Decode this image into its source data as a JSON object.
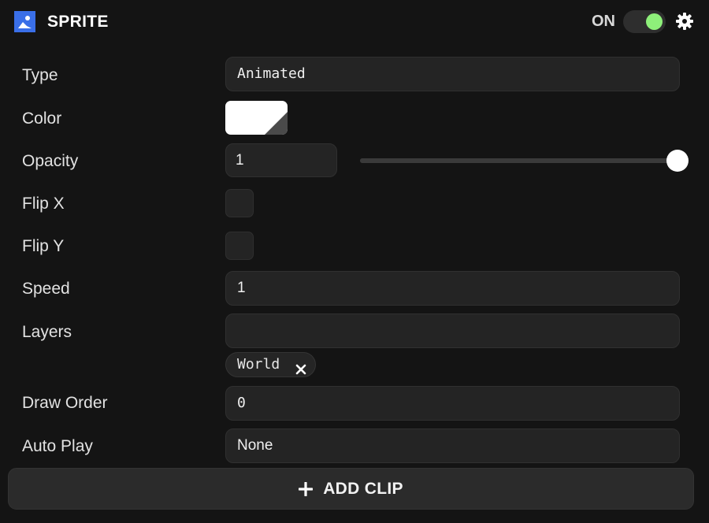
{
  "header": {
    "title": "SPRITE",
    "icon": "image-icon",
    "toggle_label": "ON",
    "toggle_on": true,
    "accent": "#3a6fe8",
    "toggle_color": "#8ef07a"
  },
  "rows": {
    "type": {
      "label": "Type",
      "value": "Animated"
    },
    "color": {
      "label": "Color",
      "value": "#ffffff"
    },
    "opacity": {
      "label": "Opacity",
      "value": "1",
      "slider_fraction": 1.0
    },
    "flip_x": {
      "label": "Flip X",
      "checked": false
    },
    "flip_y": {
      "label": "Flip Y",
      "checked": false
    },
    "speed": {
      "label": "Speed",
      "value": "1"
    },
    "layers": {
      "label": "Layers",
      "value": "",
      "chips": [
        "World"
      ]
    },
    "draw_order": {
      "label": "Draw Order",
      "value": "0"
    },
    "auto_play": {
      "label": "Auto Play",
      "value": "None"
    }
  },
  "footer": {
    "add_clip_label": "ADD CLIP",
    "icon": "plus-icon"
  }
}
